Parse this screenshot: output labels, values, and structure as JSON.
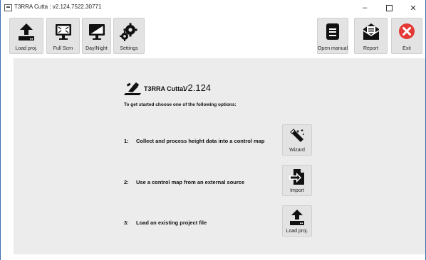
{
  "window": {
    "title": "T3RRA Cutta : v2.124.7522.30771",
    "minimize_glyph": "–",
    "close_glyph": "✕"
  },
  "toolbar": {
    "left_buttons": [
      {
        "label": "Load proj.",
        "icon": "upload-icon"
      },
      {
        "label": "Full Scrn",
        "icon": "fullscreen-monitor-icon"
      },
      {
        "label": "Day/Night",
        "icon": "day-night-monitor-icon"
      },
      {
        "label": "Settings",
        "icon": "gears-icon"
      }
    ],
    "right_buttons": [
      {
        "label": "Open manual",
        "icon": "manual-icon"
      },
      {
        "label": "Report",
        "icon": "report-envelope-icon"
      },
      {
        "label": "Exit",
        "icon": "exit-x-icon"
      }
    ]
  },
  "main": {
    "brand": "T3RRA Cutta:",
    "version": "v2.124",
    "intro": "To get started choose one of the following options:",
    "options": [
      {
        "number": "1:",
        "text": "Collect and process height data into a control map",
        "button_label": "Wizard",
        "icon": "magic-wand-icon"
      },
      {
        "number": "2:",
        "text": "Use a control map from an external source",
        "button_label": "Import",
        "icon": "import-file-icon"
      },
      {
        "number": "3:",
        "text": "Load an existing project file",
        "button_label": "Load proj.",
        "icon": "upload-icon"
      }
    ]
  },
  "colors": {
    "button_bg": "#e3e3e3",
    "main_bg": "#ececec",
    "exit_red": "#e53935",
    "window_border": "#3c6fb0"
  }
}
